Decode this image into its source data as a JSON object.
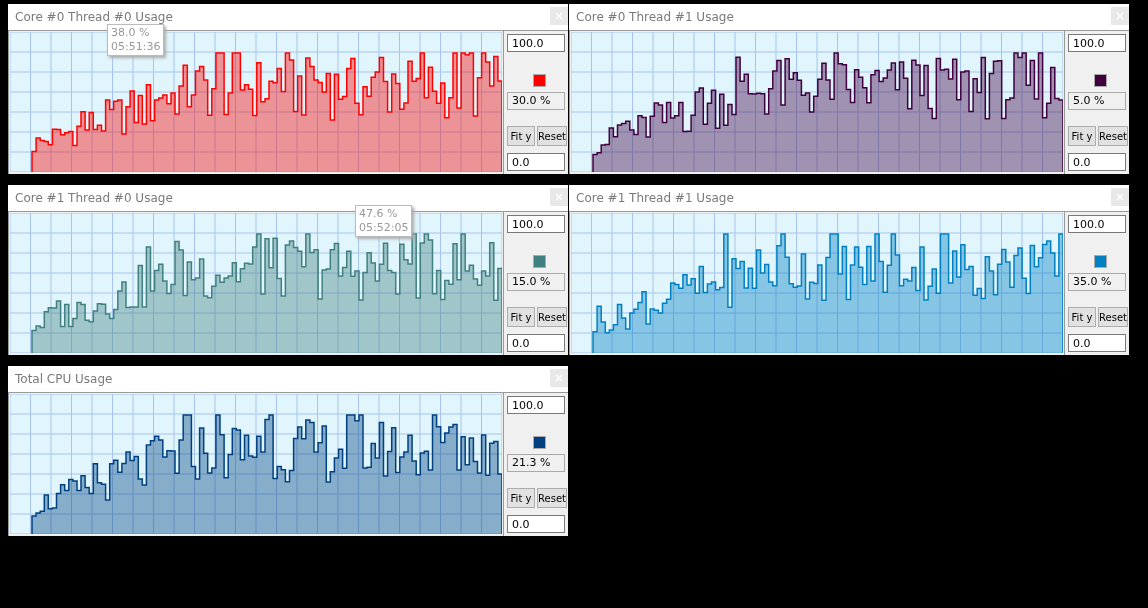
{
  "graphs": [
    {
      "title": "Core #0 Thread #0 Usage",
      "max": "100.0",
      "current": "30.0 %",
      "min": "0.0",
      "color": "#ff0000",
      "fit_button": "Fit y",
      "reset_button": "Reset",
      "tooltip": {
        "value": "38.0 %",
        "time": "05:51:36"
      }
    },
    {
      "title": "Core #0 Thread #1 Usage",
      "max": "100.0",
      "current": "5.0 %",
      "min": "0.0",
      "color": "#400040",
      "fit_button": "Fit y",
      "reset_button": "Reset"
    },
    {
      "title": "Core #1 Thread #0 Usage",
      "max": "100.0",
      "current": "15.0 %",
      "min": "0.0",
      "color": "#408080",
      "fit_button": "Fit y",
      "reset_button": "Reset",
      "tooltip": {
        "value": "47.6 %",
        "time": "05:52:05"
      }
    },
    {
      "title": "Core #1 Thread #1 Usage",
      "max": "100.0",
      "current": "35.0 %",
      "min": "0.0",
      "color": "#0080c0",
      "fit_button": "Fit y",
      "reset_button": "Reset"
    },
    {
      "title": "Total CPU Usage",
      "max": "100.0",
      "current": "21.3 %",
      "min": "0.0",
      "color": "#004080",
      "fit_button": "Fit y",
      "reset_button": "Reset"
    }
  ]
}
